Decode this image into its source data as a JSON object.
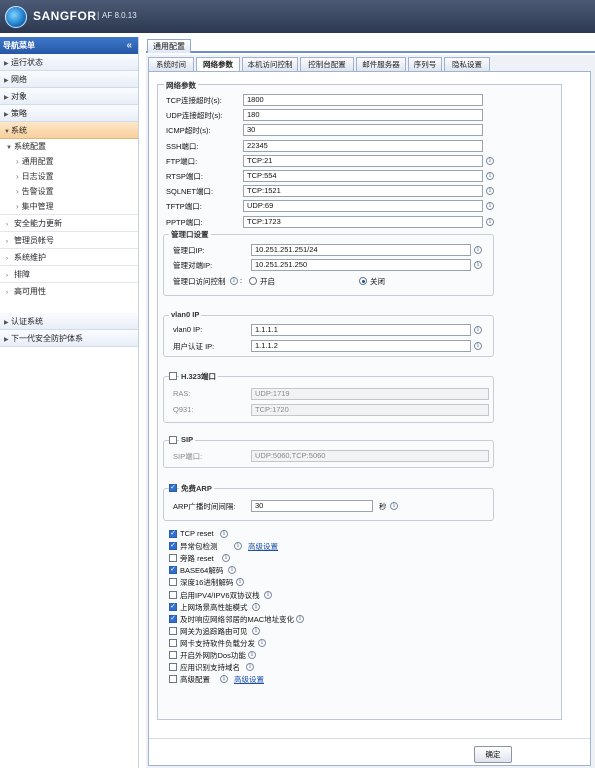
{
  "app": {
    "brand": "SANGFOR",
    "separator": "|",
    "version": "AF 8.0.13"
  },
  "sidebar": {
    "title": "导航菜单",
    "collapse": "«",
    "items": [
      {
        "label": "运行状态"
      },
      {
        "label": "网络"
      },
      {
        "label": "对象"
      },
      {
        "label": "策略"
      },
      {
        "label": "系统",
        "active": true
      }
    ],
    "system_config": "系统配置",
    "system_config_children": [
      "通用配置",
      "日志设置",
      "告警设置",
      "集中管理"
    ],
    "groups": [
      "安全能力更新",
      "管理员帐号",
      "系统维护",
      "排障",
      "高可用性"
    ],
    "bottom_items": [
      "认证系统",
      "下一代安全防护体系"
    ]
  },
  "main": {
    "top_tab": "通用配置",
    "tabs": [
      "系统时间",
      "网络参数",
      "本机访问控制",
      "控制台配置",
      "邮件服务器",
      "序列号",
      "隐私设置"
    ],
    "selected_tab": 1,
    "section_title": "网络参数",
    "params": [
      {
        "label": "TCP连接超时(s):",
        "value": "1800",
        "info": false
      },
      {
        "label": "UDP连接超时(s):",
        "value": "180",
        "info": false
      },
      {
        "label": "ICMP超时(s):",
        "value": "30",
        "info": false
      },
      {
        "label": "SSH端口:",
        "value": "22345",
        "info": false
      },
      {
        "label": "FTP端口:",
        "value": "TCP:21",
        "info": true
      },
      {
        "label": "RTSP端口:",
        "value": "TCP:554",
        "info": true
      },
      {
        "label": "SQLNET端口:",
        "value": "TCP:1521",
        "info": true
      },
      {
        "label": "TFTP端口:",
        "value": "UDP:69",
        "info": true
      },
      {
        "label": "PPTP端口:",
        "value": "TCP:1723",
        "info": true
      }
    ],
    "mgmt": {
      "title": "管理口设置",
      "ip_label": "管理口IP:",
      "ip_value": "10.251.251.251/24",
      "peer_label": "管理对端IP:",
      "peer_value": "10.251.251.250",
      "access_label": "管理口访问控制",
      "access_sep": ":",
      "on_label": "开启",
      "off_label": "关闭",
      "selected": "off"
    },
    "vlan": {
      "title": "vlan0 IP",
      "ip_label": "vlan0 IP:",
      "ip_value": "1.1.1.1",
      "auth_label": "用户认证 IP:",
      "auth_value": "1.1.1.2"
    },
    "h323": {
      "title": "H.323端口",
      "checked": false,
      "ras_label": "RAS:",
      "ras_value": "UDP:1719",
      "q931_label": "Q931:",
      "q931_value": "TCP:1720"
    },
    "sip": {
      "title": "SIP",
      "checked": false,
      "port_label": "SIP端口:",
      "port_value": "UDP:5060,TCP:5060"
    },
    "arp": {
      "title": "免费ARP",
      "checked": true,
      "interval_label": "ARP广播时间间隔:",
      "interval_value": "30",
      "unit": "秒"
    },
    "options": [
      {
        "label": "TCP reset",
        "checked": true,
        "info": true,
        "link": ""
      },
      {
        "label": "异常包检测",
        "checked": true,
        "info": true,
        "link": "高级设置"
      },
      {
        "label": "旁路 reset",
        "checked": false,
        "info": true,
        "link": ""
      },
      {
        "label": "BASE64解码",
        "checked": true,
        "info": true,
        "link": ""
      },
      {
        "label": "深度16进制解码",
        "checked": false,
        "info": true,
        "link": ""
      },
      {
        "label": "启用IPV4/IPV6双协议栈",
        "checked": false,
        "info": true,
        "link": ""
      },
      {
        "label": "上网场景高性能模式",
        "checked": true,
        "info": true,
        "link": ""
      },
      {
        "label": "及时响应网络邻居的MAC地址变化",
        "checked": true,
        "info": true,
        "link": ""
      },
      {
        "label": "网关为追踪路由可见",
        "checked": false,
        "info": true,
        "link": ""
      },
      {
        "label": "网卡支持软件负载分发",
        "checked": false,
        "info": true,
        "link": ""
      },
      {
        "label": "开启外网防Dos功能",
        "checked": false,
        "info": true,
        "link": ""
      },
      {
        "label": "应用识别支持域名",
        "checked": false,
        "info": true,
        "link": ""
      },
      {
        "label": "高级配置",
        "checked": false,
        "info": true,
        "link": "高级设置"
      }
    ],
    "ok_label": "确定",
    "info_glyph": "i",
    "check_glyph": "✓"
  }
}
